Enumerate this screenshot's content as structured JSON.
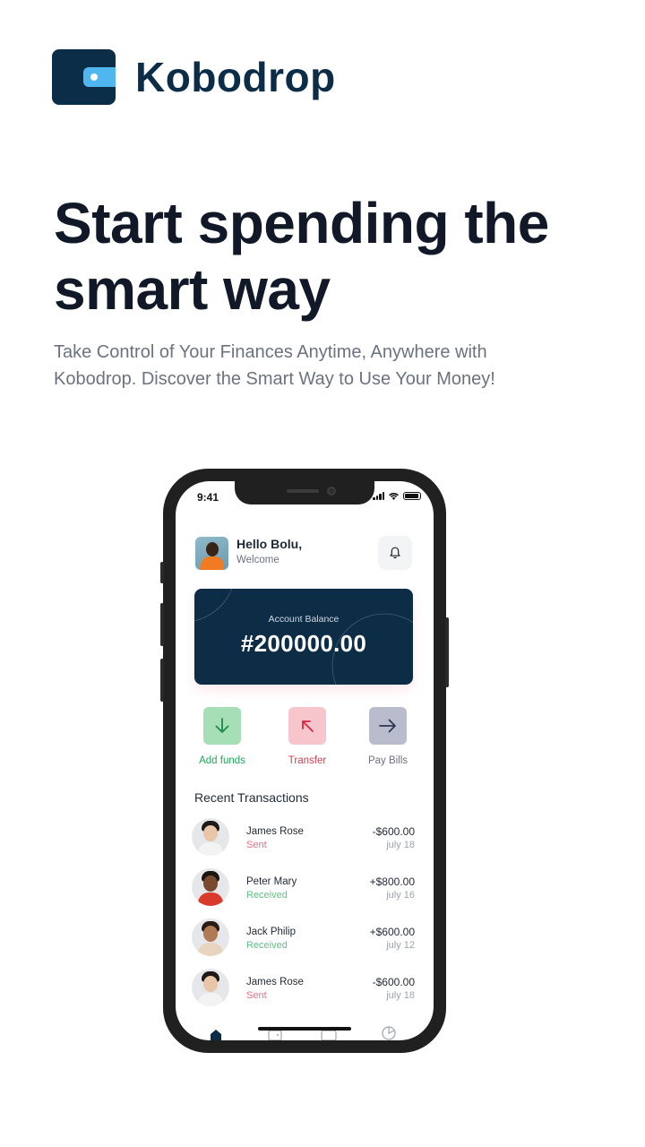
{
  "brand": {
    "name": "Kobodrop",
    "colors": {
      "primary": "#0c2d48",
      "accent": "#4fb6ef"
    }
  },
  "hero": {
    "title": "Start spending the smart way",
    "subtitle": "Take Control of Your Finances Anytime, Anywhere with Kobodrop. Discover the Smart Way to Use Your Money!"
  },
  "phone": {
    "status": {
      "time": "9:41"
    },
    "header": {
      "greeting": "Hello Bolu,",
      "welcome": "Welcome",
      "icon": "bell-icon"
    },
    "balance": {
      "label": "Account Balance",
      "amount": "#200000.00"
    },
    "actions": [
      {
        "label": "Add funds",
        "icon": "arrow-down-icon",
        "color": "#22a55a"
      },
      {
        "label": "Transfer",
        "icon": "arrow-up-left-icon",
        "color": "#e0384f"
      },
      {
        "label": "Pay Bills",
        "icon": "arrow-right-icon",
        "color": "#6b7280"
      }
    ],
    "recent_title": "Recent Transactions",
    "transactions": [
      {
        "name": "James Rose",
        "status": "Sent",
        "amount": "-$600.00",
        "date": "july 18"
      },
      {
        "name": "Peter Mary",
        "status": "Received",
        "amount": "+$800.00",
        "date": "july 16"
      },
      {
        "name": "Jack Philip",
        "status": "Received",
        "amount": "+$600.00",
        "date": "july 12"
      },
      {
        "name": "James Rose",
        "status": "Sent",
        "amount": "-$600.00",
        "date": "july 18"
      }
    ],
    "tabbar": [
      "home-icon",
      "wallet-icon",
      "card-icon",
      "pie-chart-icon"
    ]
  }
}
